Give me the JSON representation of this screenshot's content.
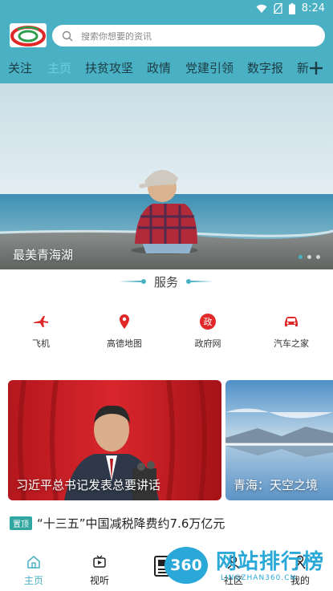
{
  "status_bar": {
    "time": "8:24"
  },
  "header": {
    "logo": "brand-logo",
    "search_placeholder": "搜索你想要的资讯"
  },
  "tabs": [
    {
      "label": "关注"
    },
    {
      "label": "主页",
      "active": true
    },
    {
      "label": "扶贫攻坚"
    },
    {
      "label": "政情"
    },
    {
      "label": "党建引领"
    },
    {
      "label": "数字报"
    },
    {
      "label": "新"
    }
  ],
  "banner": {
    "caption": "最美青海湖",
    "slide_count": 3,
    "active_slide": 1
  },
  "services": {
    "title": "服务",
    "items": [
      {
        "label": "飞机",
        "icon": "plane-icon"
      },
      {
        "label": "高德地图",
        "icon": "map-pin-icon"
      },
      {
        "label": "政府网",
        "icon": "gov-icon",
        "badge": "政"
      },
      {
        "label": "汽车之家",
        "icon": "car-icon"
      }
    ]
  },
  "cards": [
    {
      "caption": "习近平总书记发表总要讲话"
    },
    {
      "caption": "青海：天空之境"
    }
  ],
  "ticker": {
    "badge": "置顶",
    "text": "“十三五”中国减税降费约7.6万亿元"
  },
  "bottom_nav": [
    {
      "label": "主页",
      "icon": "home-icon",
      "active": true
    },
    {
      "label": "视听",
      "icon": "video-icon"
    },
    {
      "label": "",
      "icon": "newspaper-icon"
    },
    {
      "label": "社区",
      "icon": "community-icon"
    },
    {
      "label": "我的",
      "icon": "user-icon"
    }
  ],
  "watermark": {
    "badge": "360",
    "text": "网站排行榜",
    "sub": "LINGZHAN360.CN"
  },
  "colors": {
    "brand": "#4ab0c4",
    "accent_tab": "#69d0dd",
    "badge": "#2fa6a0",
    "gov_red": "#e02828"
  }
}
